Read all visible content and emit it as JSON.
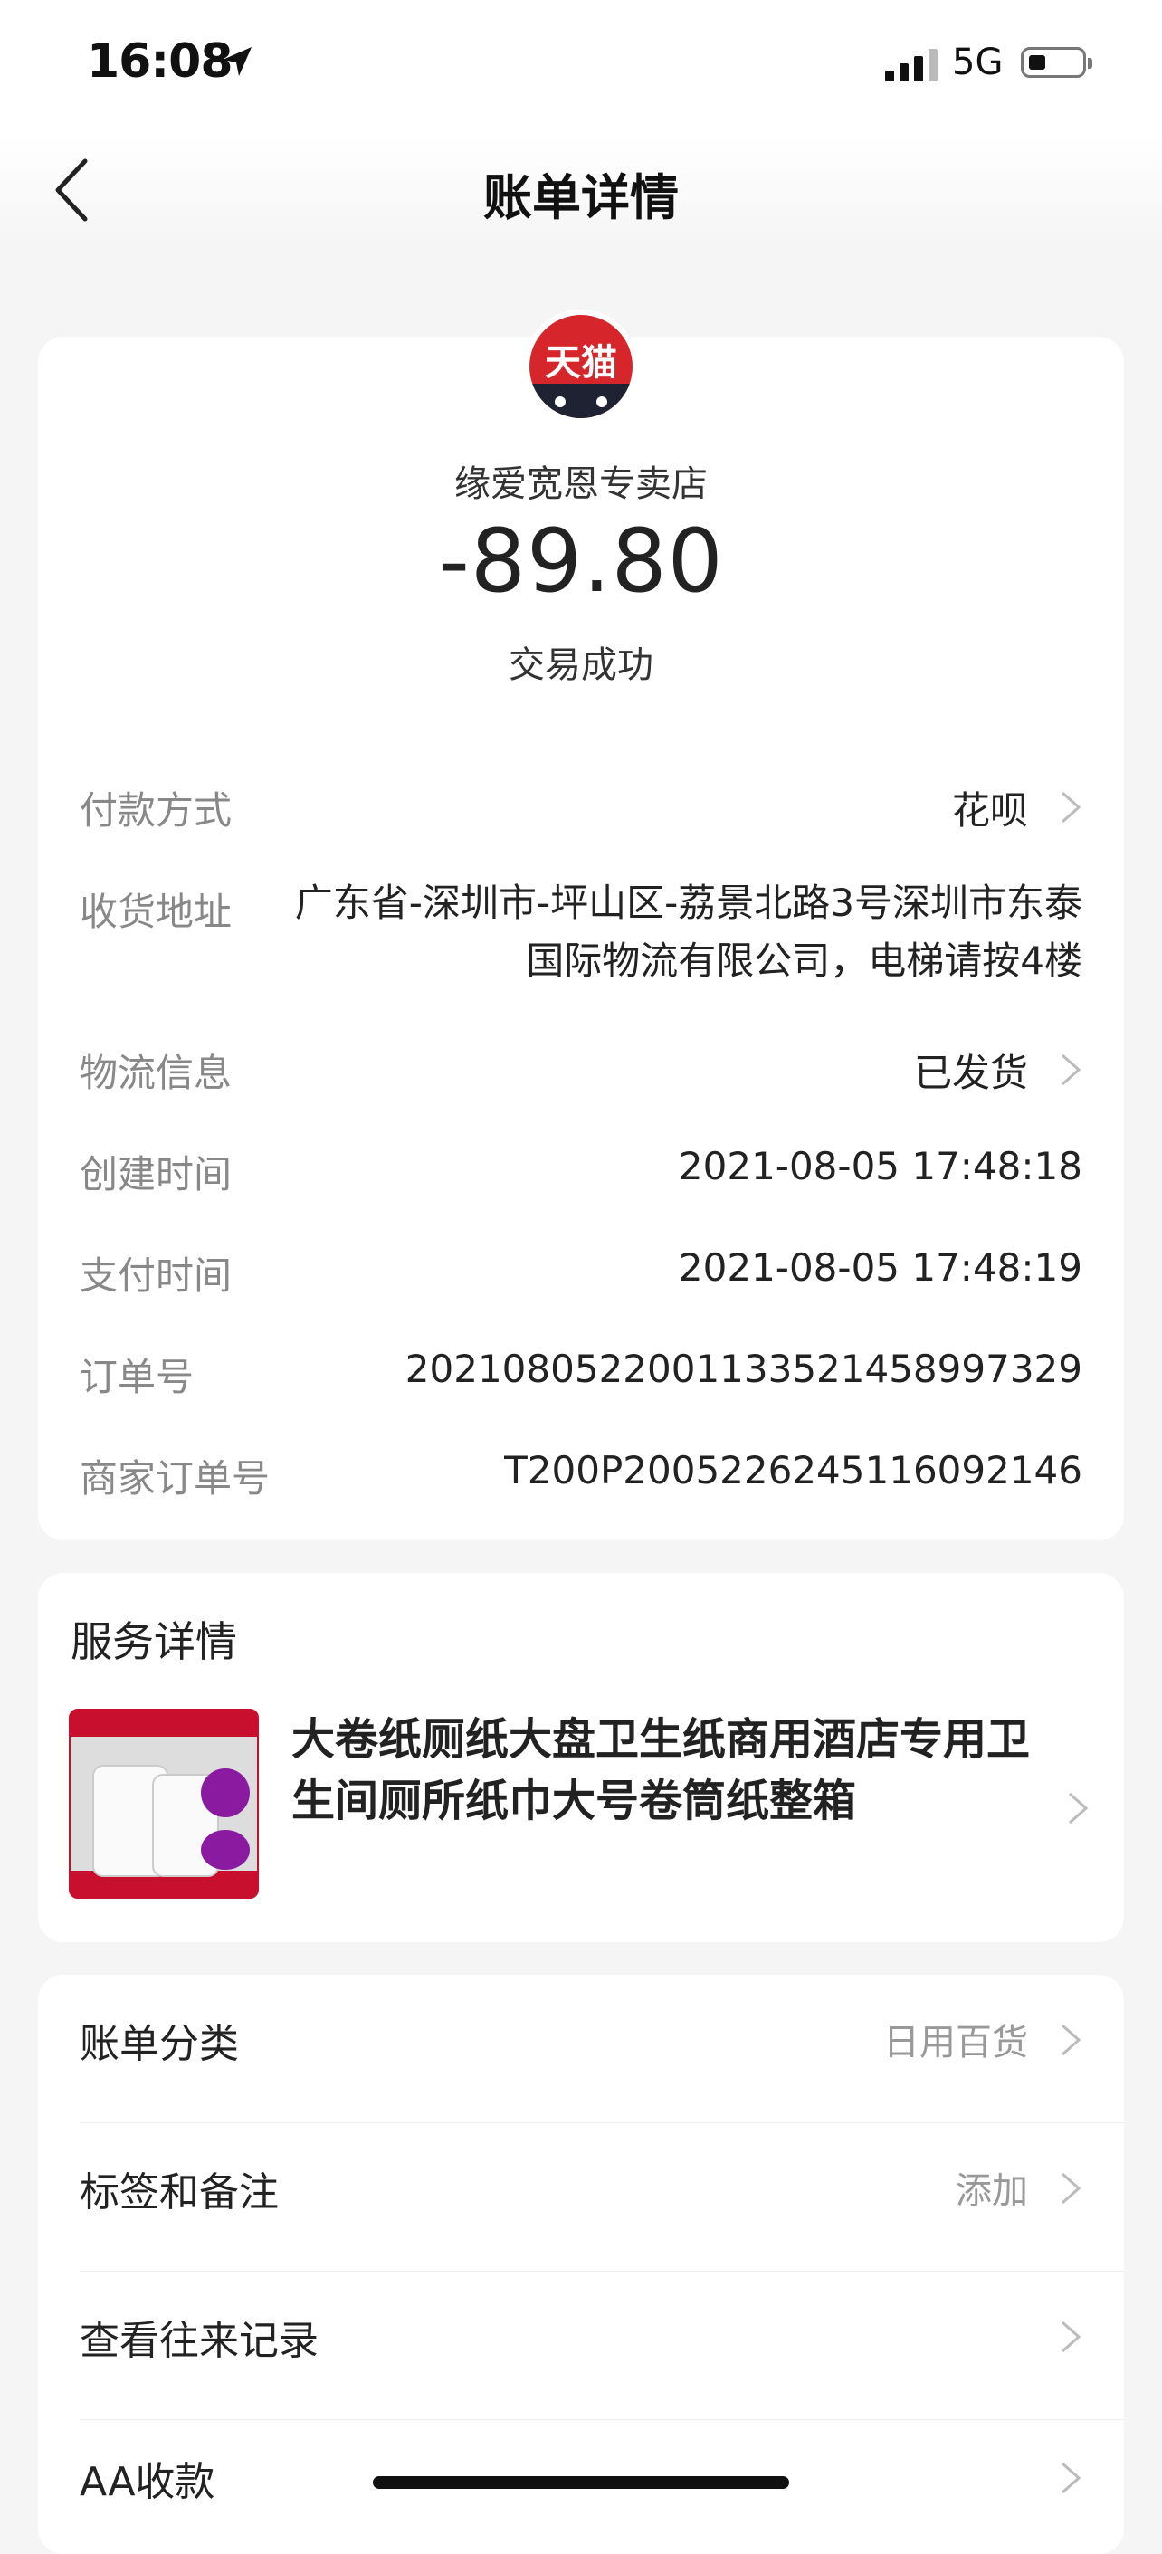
{
  "status_bar": {
    "time": "16:08",
    "network": "5G"
  },
  "nav": {
    "title": "账单详情"
  },
  "summary": {
    "avatar_text": "天猫",
    "merchant": "缘爱宽恩专卖店",
    "amount": "-89.80",
    "status": "交易成功"
  },
  "details": [
    {
      "label": "付款方式",
      "value": "花呗"
    },
    {
      "label": "收货地址",
      "value": "广东省-深圳市-坪山区-荔景北路3号深圳市东泰国际物流有限公司，电梯请按4楼"
    },
    {
      "label": "物流信息",
      "value": "已发货"
    },
    {
      "label": "创建时间",
      "value": "2021-08-05 17:48:18"
    },
    {
      "label": "支付时间",
      "value": "2021-08-05 17:48:19"
    },
    {
      "label": "订单号",
      "value": "2021080522001133521458997329"
    },
    {
      "label": "商家订单号",
      "value": "T200P2005226245116092146"
    }
  ],
  "service": {
    "title": "服务详情",
    "product_name": "大卷纸厕纸大盘卫生纸商用酒店专用卫生间厕所纸巾大号卷筒纸整箱"
  },
  "actions": [
    {
      "label": "账单分类",
      "value": "日用百货"
    },
    {
      "label": "标签和备注",
      "value": "添加"
    },
    {
      "label": "查看往来记录",
      "value": ""
    },
    {
      "label": "AA收款",
      "value": ""
    }
  ]
}
